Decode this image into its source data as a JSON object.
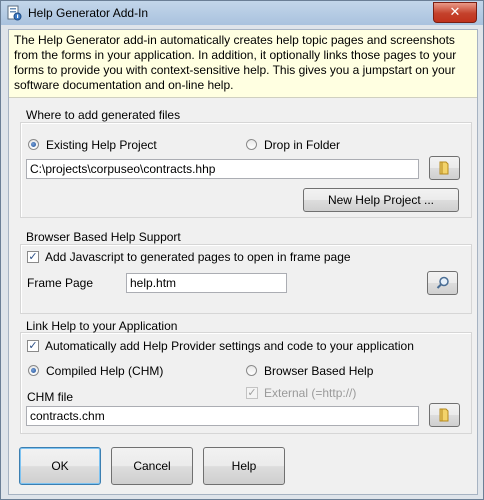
{
  "window": {
    "title": "Help Generator Add-In",
    "close_glyph": "✕",
    "app_icon": "help-generator-app-icon"
  },
  "description": "The Help Generator add-in automatically creates help topic pages and  screenshots from the forms in your application. In addition, it optionally links those pages to your forms to provide you with context-sensitive help. This gives you a jumpstart on your software documentation and on-line help.",
  "where_group": {
    "title": "Where to add generated files",
    "option_existing": "Existing Help Project",
    "option_drop": "Drop in Folder",
    "selected": "existing",
    "path_value": "C:\\projects\\corpuseo\\contracts.hhp",
    "browse_icon": "folder-icon",
    "new_project_label": "New Help Project ..."
  },
  "browser_group": {
    "title": "Browser Based Help Support",
    "add_js_label": "Add Javascript to generated pages to open in frame page",
    "add_js_checked": true,
    "frame_page_label": "Frame Page",
    "frame_page_value": "help.htm",
    "search_icon": "magnifier-icon"
  },
  "link_group": {
    "title": "Link Help to your Application",
    "auto_add_label": "Automatically add Help Provider settings and code to your application",
    "auto_add_checked": true,
    "option_chm": "Compiled Help (CHM)",
    "option_browser": "Browser Based Help",
    "selected": "chm",
    "external_label": "External (=http://)",
    "external_checked": true,
    "external_enabled": false,
    "chm_file_label": "CHM file",
    "chm_file_value": "contracts.chm",
    "browse_icon": "folder-icon"
  },
  "buttons": {
    "ok": "OK",
    "cancel": "Cancel",
    "help": "Help"
  },
  "colors": {
    "info_background": "#ffffe1",
    "title_bar": "#b9cfe6",
    "close_button": "#c4412b"
  }
}
